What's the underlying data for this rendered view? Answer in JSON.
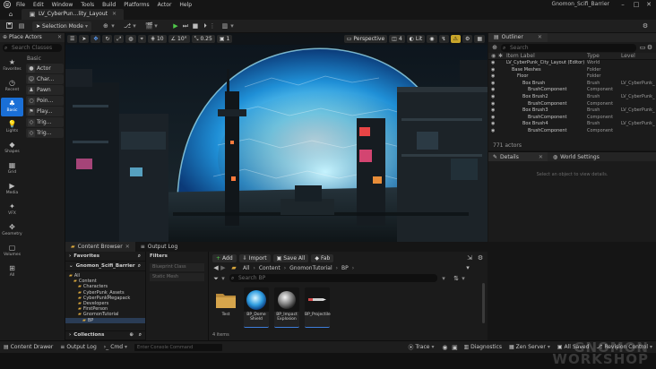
{
  "app": {
    "menu": [
      "File",
      "Edit",
      "Window",
      "Tools",
      "Build",
      "Platforms",
      "Actor",
      "Help"
    ],
    "project_name": "Gnomon_Scifi_Barrier",
    "level_tab": "LV_CyberPun...lity_Layout"
  },
  "toolbar": {
    "mode": "Selection Mode"
  },
  "place_actors": {
    "title": "Place Actors",
    "search_placeholder": "Search Classes",
    "section": "Basic",
    "categories": [
      "Favorites",
      "Recent",
      "Basic",
      "Lights",
      "Shapes",
      "Grid",
      "Media",
      "VFX",
      "Geometry",
      "Volumes",
      "All"
    ],
    "items": [
      "Actor",
      "Char...",
      "Pawn",
      "Poin...",
      "Play...",
      "Trig...",
      "Trig..."
    ]
  },
  "viewport": {
    "perspective": "Perspective",
    "lit": "Lit",
    "fov": "4",
    "snap_translate": "10",
    "snap_rotate": "10°",
    "snap_scale": "0.25",
    "camera_speed": "1"
  },
  "outliner": {
    "title": "Outliner",
    "search_placeholder": "Search",
    "columns": [
      "Item Label",
      "Type",
      "Level"
    ],
    "rows": [
      {
        "label": "LV_CyberPunk_City_Layout (Editor)",
        "type": "World",
        "level": "",
        "indent": 0
      },
      {
        "label": "Base Meshes",
        "type": "Folder",
        "level": "",
        "indent": 1
      },
      {
        "label": "Floor",
        "type": "Folder",
        "level": "",
        "indent": 2
      },
      {
        "label": "Box Brush",
        "type": "Brush",
        "level": "LV_CyberPunk_",
        "indent": 3
      },
      {
        "label": "BrushComponent",
        "type": "Component",
        "level": "",
        "indent": 4
      },
      {
        "label": "Box Brush2",
        "type": "Brush",
        "level": "LV_CyberPunk_",
        "indent": 3
      },
      {
        "label": "BrushComponent",
        "type": "Component",
        "level": "",
        "indent": 4
      },
      {
        "label": "Box Brush3",
        "type": "Brush",
        "level": "LV_CyberPunk_",
        "indent": 3
      },
      {
        "label": "BrushComponent",
        "type": "Component",
        "level": "",
        "indent": 4
      },
      {
        "label": "Box Brush4",
        "type": "Brush",
        "level": "LV_CyberPunk_",
        "indent": 3
      },
      {
        "label": "BrushComponent",
        "type": "Component",
        "level": "",
        "indent": 4
      }
    ],
    "actor_count": "771 actors"
  },
  "details": {
    "tab": "Details",
    "world_settings_tab": "World Settings",
    "hint": "Select an object to view details."
  },
  "content_browser": {
    "tab": "Content Browser",
    "output_tab": "Output Log",
    "favorites": "Favorites",
    "project": "Gnomon_Scifi_Barrier",
    "filters": "Filters",
    "filter_items": [
      "Blueprint Class",
      "Static Mesh"
    ],
    "tree": [
      {
        "name": "All",
        "indent": 0
      },
      {
        "name": "Content",
        "indent": 1
      },
      {
        "name": "Characters",
        "indent": 2
      },
      {
        "name": "CyberPunk_Assets",
        "indent": 2
      },
      {
        "name": "CyberPunkMegapack",
        "indent": 2
      },
      {
        "name": "Developers",
        "indent": 2
      },
      {
        "name": "FirstPerson",
        "indent": 2
      },
      {
        "name": "GnomonTutorial",
        "indent": 2
      },
      {
        "name": "BP",
        "indent": 3
      }
    ],
    "collections": "Collections",
    "add": "Add",
    "import": "Import",
    "save_all": "Save All",
    "fab": "Fab",
    "path": [
      "All",
      "Content",
      "GnomonTutorial",
      "BP"
    ],
    "search_placeholder": "Search BP",
    "assets": [
      {
        "name": "Test",
        "kind": "folder"
      },
      {
        "name": "BP_Dome Shield",
        "kind": "dome"
      },
      {
        "name": "BP_Impact Explosion",
        "kind": "sphere"
      },
      {
        "name": "BP_Projectile",
        "kind": "projectile"
      }
    ],
    "item_count": "4 items"
  },
  "statusbar": {
    "content_drawer": "Content Drawer",
    "output_log": "Output Log",
    "cmd": "Cmd",
    "cmd_placeholder": "Enter Console Command",
    "trace": "Trace",
    "diagnostics": "Diagnostics",
    "zen_server": "Zen Server",
    "all_saved": "All Saved",
    "revision_control": "Revision Control"
  },
  "watermark": {
    "line1": "GNOMON",
    "line2": "WORKSHOP"
  }
}
